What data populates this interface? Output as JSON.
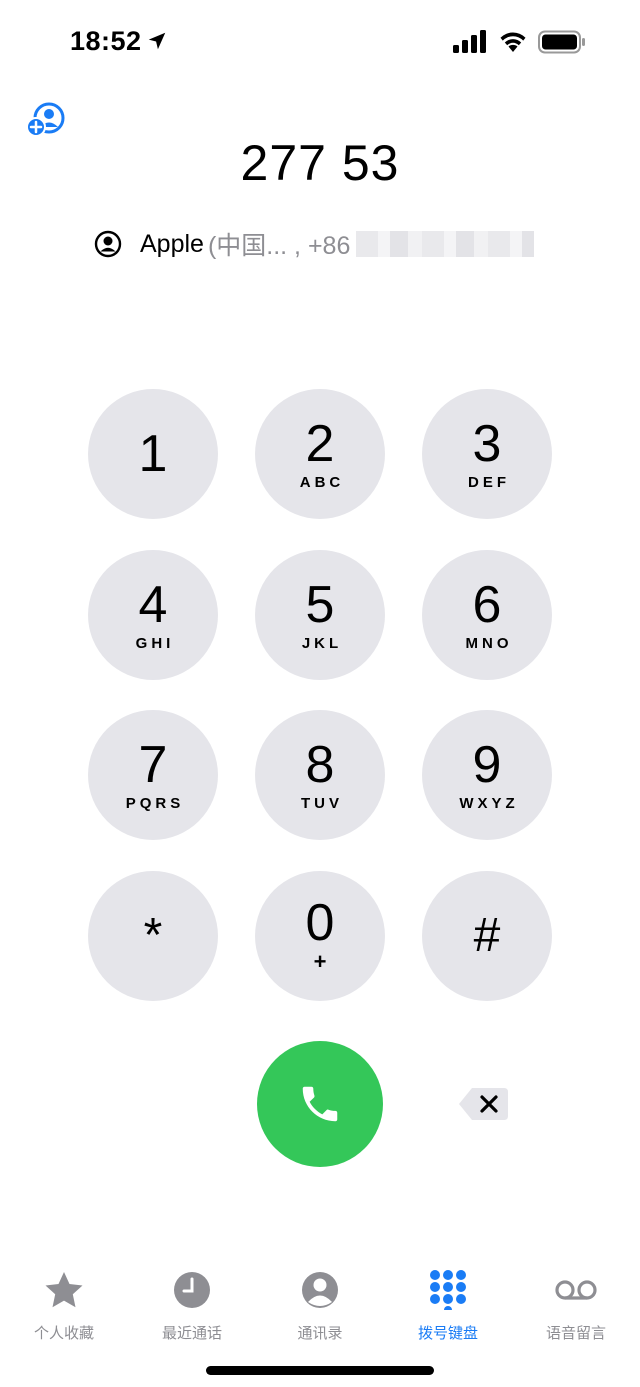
{
  "status_bar": {
    "time": "18:52"
  },
  "dialer": {
    "number": "277 53",
    "suggestion": {
      "name": "Apple",
      "detail": "(中国... , +86"
    }
  },
  "keypad": [
    {
      "digit": "1",
      "letters": ""
    },
    {
      "digit": "2",
      "letters": "ABC"
    },
    {
      "digit": "3",
      "letters": "DEF"
    },
    {
      "digit": "4",
      "letters": "GHI"
    },
    {
      "digit": "5",
      "letters": "JKL"
    },
    {
      "digit": "6",
      "letters": "MNO"
    },
    {
      "digit": "7",
      "letters": "PQRS"
    },
    {
      "digit": "8",
      "letters": "TUV"
    },
    {
      "digit": "9",
      "letters": "WXYZ"
    },
    {
      "digit": "*",
      "letters": ""
    },
    {
      "digit": "0",
      "letters": "+"
    },
    {
      "digit": "#",
      "letters": ""
    }
  ],
  "tabs": [
    {
      "label": "个人收藏",
      "icon": "star-icon"
    },
    {
      "label": "最近通话",
      "icon": "clock-icon"
    },
    {
      "label": "通讯录",
      "icon": "contacts-icon"
    },
    {
      "label": "拨号键盘",
      "icon": "keypad-icon",
      "active": true
    },
    {
      "label": "语音留言",
      "icon": "voicemail-icon"
    }
  ],
  "colors": {
    "accent": "#1a7cf5",
    "call": "#34c759",
    "key": "#e5e5ea",
    "inactive": "#8e8e93"
  }
}
